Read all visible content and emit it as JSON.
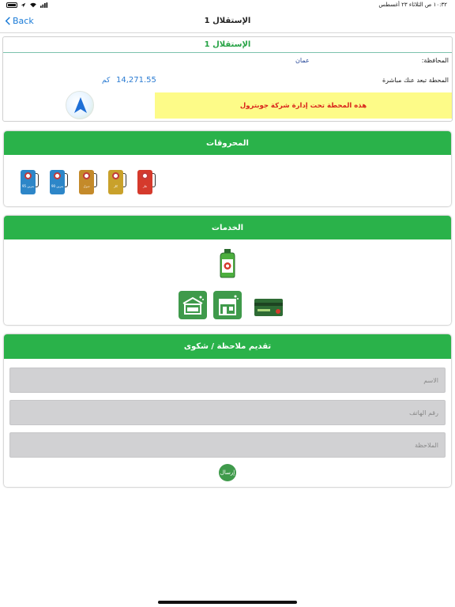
{
  "status_bar": {
    "datetime": "١٠:٣٢ ص   الثلاثاء ٢٣ أغسطس"
  },
  "navbar": {
    "back_label": "Back",
    "title": "الإستقلال 1"
  },
  "station": {
    "name": "الإستقلال 1",
    "governorate_label": "المحافظة:",
    "governorate_value": "عمان",
    "distance_label": "المحطة تبعد عنك مباشرة",
    "distance_value": "14,271.55",
    "distance_unit": "كم",
    "notice": "هذه المحطة تحت إدارة شركة جوبترول"
  },
  "fuels": {
    "header": "المحروقات",
    "items": [
      {
        "icon": "fuel-pump-95-icon",
        "text": "بنزين 95",
        "color": "#2d86c8"
      },
      {
        "icon": "fuel-pump-90-icon",
        "text": "بنزين 90",
        "color": "#2d86c8"
      },
      {
        "icon": "fuel-pump-diesel-icon",
        "text": "ديزل",
        "color": "#c48a2a"
      },
      {
        "icon": "fuel-pump-kerosene-icon",
        "text": "كاز",
        "color": "#c9a12b"
      },
      {
        "icon": "fuel-pump-gas-icon",
        "text": "غاز",
        "color": "#d53a2c"
      }
    ]
  },
  "services": {
    "header": "الخدمات"
  },
  "feedback": {
    "header": "تقديم ملاحظة / شكوى",
    "name_placeholder": "الاسم",
    "phone_placeholder": "رقم الهاتف",
    "note_placeholder": "الملاحظة",
    "send_label": "إرسال"
  },
  "colors": {
    "accent_green": "#2ab24a",
    "link_blue": "#1a7bd7",
    "notice_bg": "#fdfb88",
    "notice_text": "#d9241b"
  }
}
